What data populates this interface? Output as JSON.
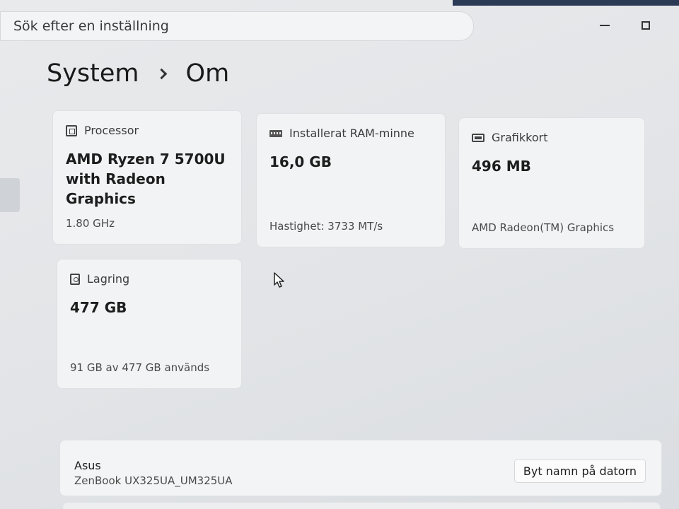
{
  "topbar": {
    "search_placeholder": "Sök efter en inställning"
  },
  "breadcrumb": {
    "parent": "System",
    "current": "Om"
  },
  "specs": {
    "processor": {
      "icon": "cpu-icon",
      "title": "Processor",
      "value": "AMD Ryzen 7 5700U with Radeon Graphics",
      "sub": "1.80 GHz"
    },
    "ram": {
      "icon": "memory-icon",
      "title": "Installerat RAM-minne",
      "value": "16,0 GB",
      "sub": "Hastighet: 3733 MT/s"
    },
    "gpu": {
      "icon": "graphics-card-icon",
      "title": "Grafikkort",
      "value": "496 MB",
      "sub": "AMD Radeon(TM) Graphics"
    },
    "storage": {
      "icon": "storage-icon",
      "title": "Lagring",
      "value": "477 GB",
      "sub": "91 GB av 477 GB används"
    }
  },
  "device": {
    "name": "Asus",
    "model": "ZenBook UX325UA_UM325UA",
    "rename_label": "Byt namn på datorn"
  }
}
